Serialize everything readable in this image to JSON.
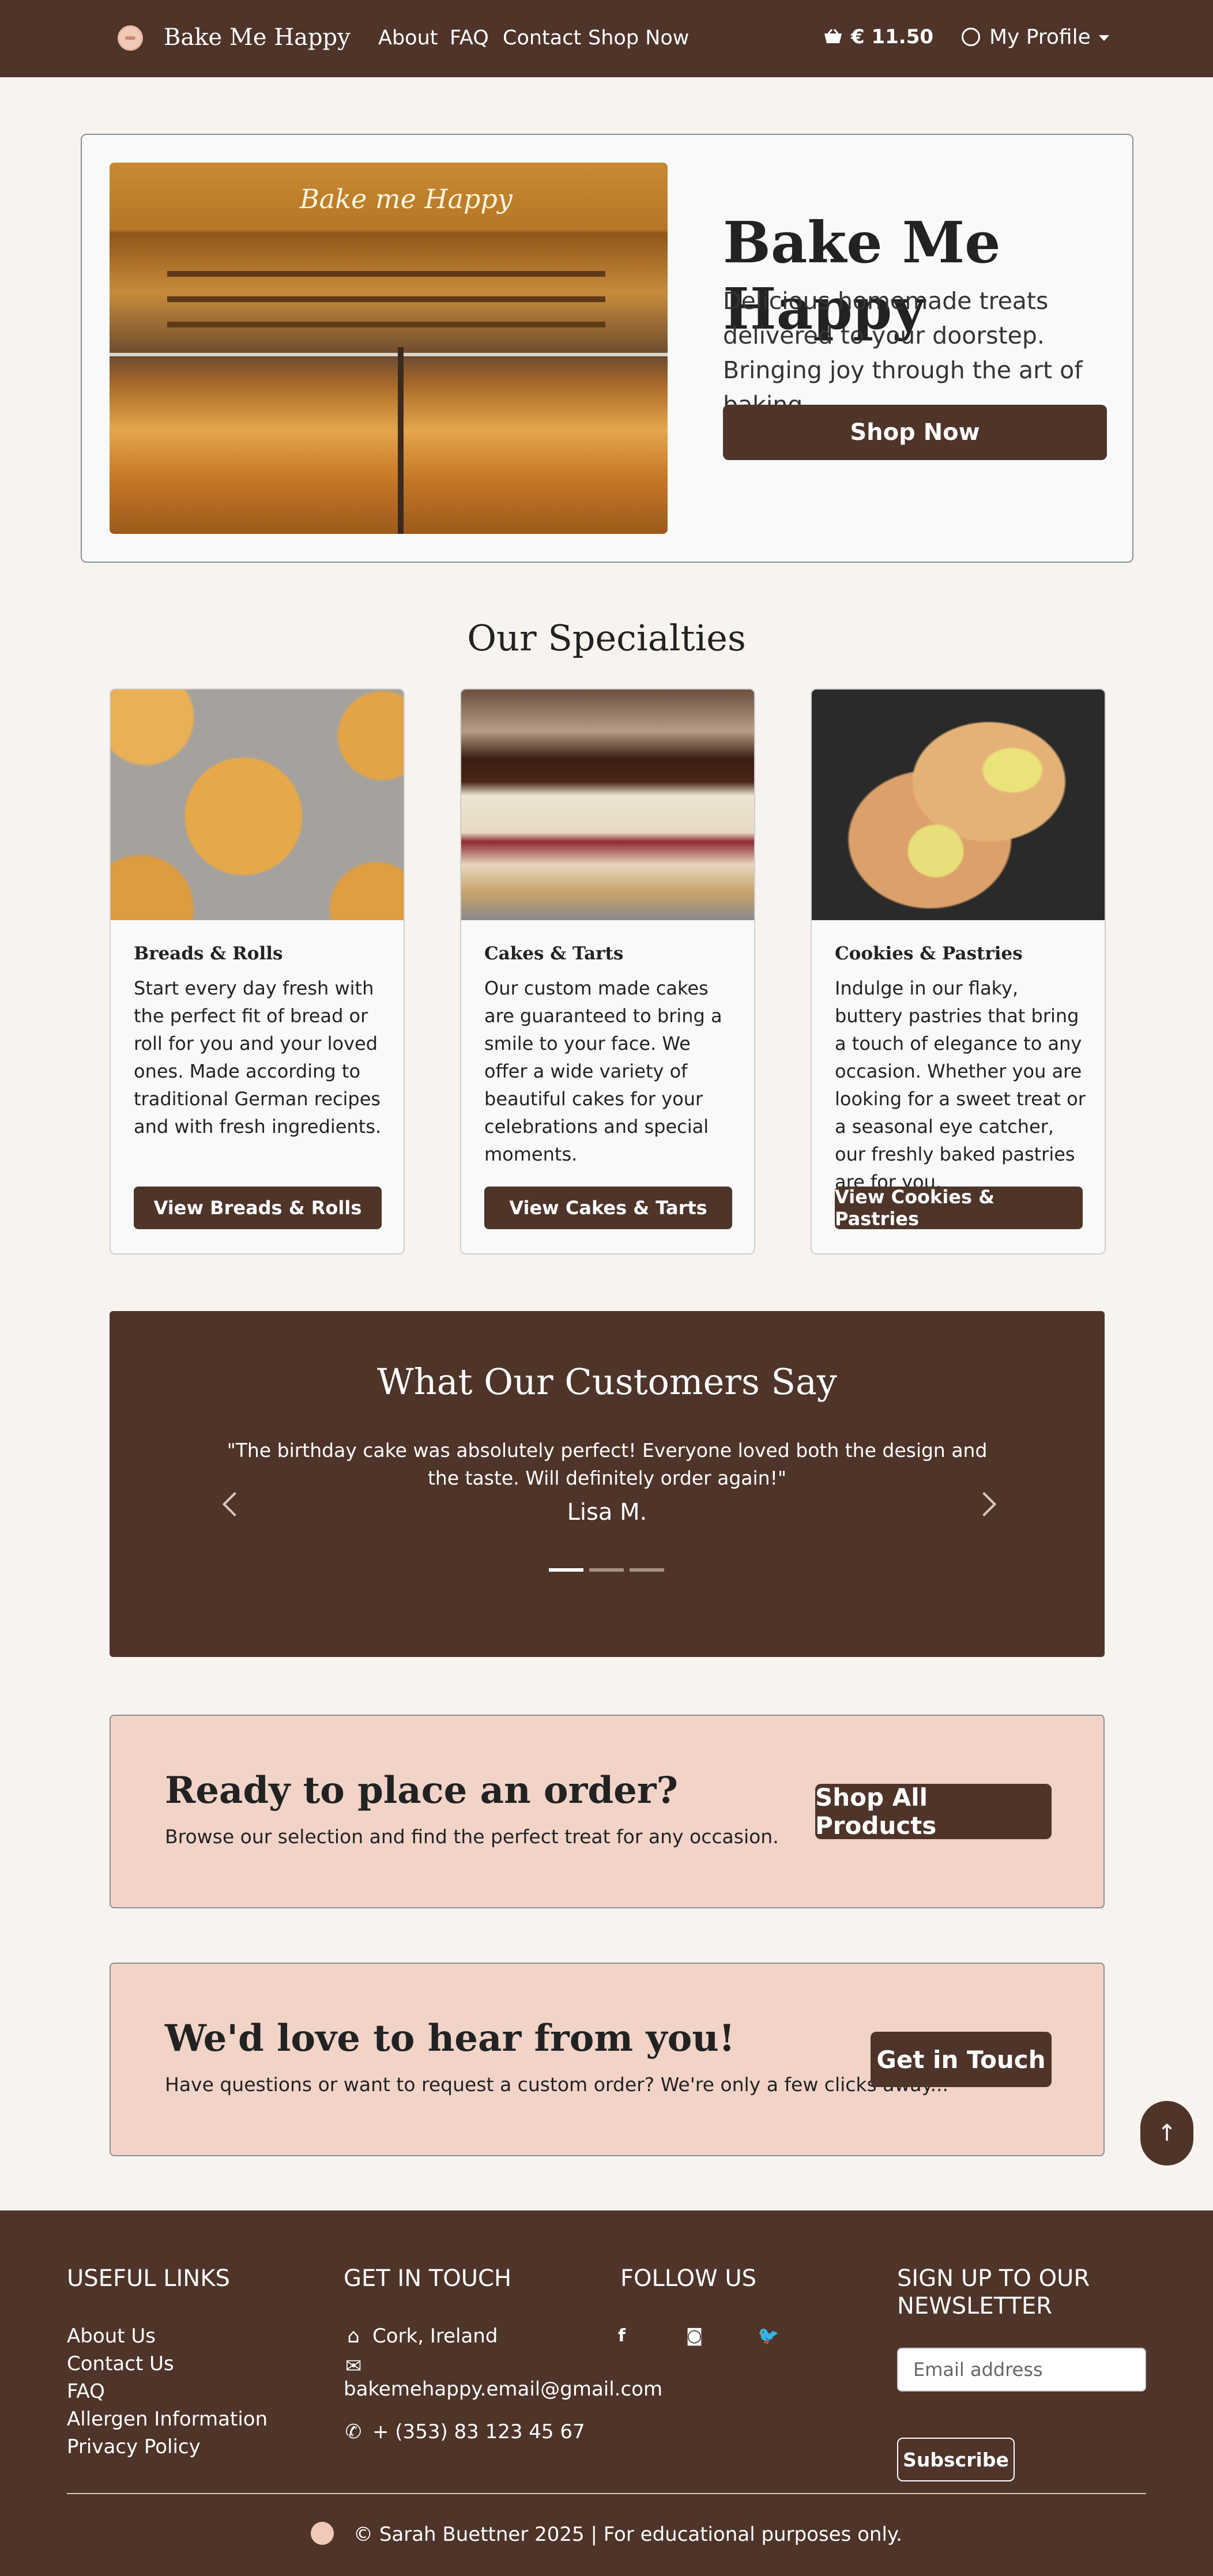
{
  "nav": {
    "brand": "Bake Me Happy",
    "links": [
      "About",
      "FAQ",
      "Contact",
      "Shop Now"
    ],
    "cart_total": "€ 11.50",
    "profile_label": "My Profile"
  },
  "hero": {
    "image_sign": "Bake me Happy",
    "title": "Bake Me Happy",
    "subtitle": "Delicious homemade treats delivered to your doorstep. Bringing joy through the art of baking.",
    "button": "Shop Now"
  },
  "specialties": {
    "title": "Our Specialties",
    "cards": [
      {
        "title": "Breads & Rolls",
        "text": "Start every day fresh with the perfect fit of bread or roll for you and your loved ones. Made according to traditional German recipes and with fresh ingredients.",
        "button": "View Breads & Rolls"
      },
      {
        "title": "Cakes & Tarts",
        "text": "Our custom made cakes are guaranteed to bring a smile to your face. We offer a wide variety of beautiful cakes for your celebrations and special moments.",
        "button": "View Cakes & Tarts"
      },
      {
        "title": "Cookies & Pastries",
        "text": "Indulge in our flaky, buttery pastries that bring a touch of elegance to any occasion. Whether you are looking for a sweet treat or a seasonal eye catcher, our freshly baked pastries are for you.",
        "button": "View Cookies & Pastries"
      }
    ]
  },
  "testimonials": {
    "title": "What Our Customers Say",
    "quote": "\"The birthday cake was absolutely perfect! Everyone loved both the design and the taste. Will definitely order again!\"",
    "author": "Lisa M.",
    "active_slide": 1,
    "slide_count": 3
  },
  "cta_order": {
    "title": "Ready to place an order?",
    "text": "Browse our selection and find the perfect treat for any occasion.",
    "button": "Shop All Products"
  },
  "cta_contact": {
    "title": "We'd love to hear from you!",
    "text": "Have questions or want to request a custom order? We're only a few clicks away...",
    "button": "Get in Touch"
  },
  "footer": {
    "useful_links": {
      "heading": "USEFUL LINKS",
      "items": [
        "About Us",
        "Contact Us",
        "FAQ",
        "Allergen Information",
        "Privacy Policy"
      ]
    },
    "get_in_touch": {
      "heading": "GET IN TOUCH",
      "location": "Cork, Ireland",
      "email": "bakemehappy.email@gmail.com",
      "phone": "+ (353) 83 123 45 67"
    },
    "follow_us": {
      "heading": "FOLLOW US",
      "icons": [
        "facebook-icon",
        "instagram-icon",
        "twitter-icon"
      ]
    },
    "newsletter": {
      "heading": "SIGN UP TO OUR NEWSLETTER",
      "placeholder": "Email address",
      "button": "Subscribe"
    },
    "copyright": "© Sarah Buettner 2025 | For educational purposes only."
  },
  "colors": {
    "brand_brown": "#4e3429",
    "cta_pink": "#f2d3c7",
    "page_bg": "#f7f4f0"
  }
}
